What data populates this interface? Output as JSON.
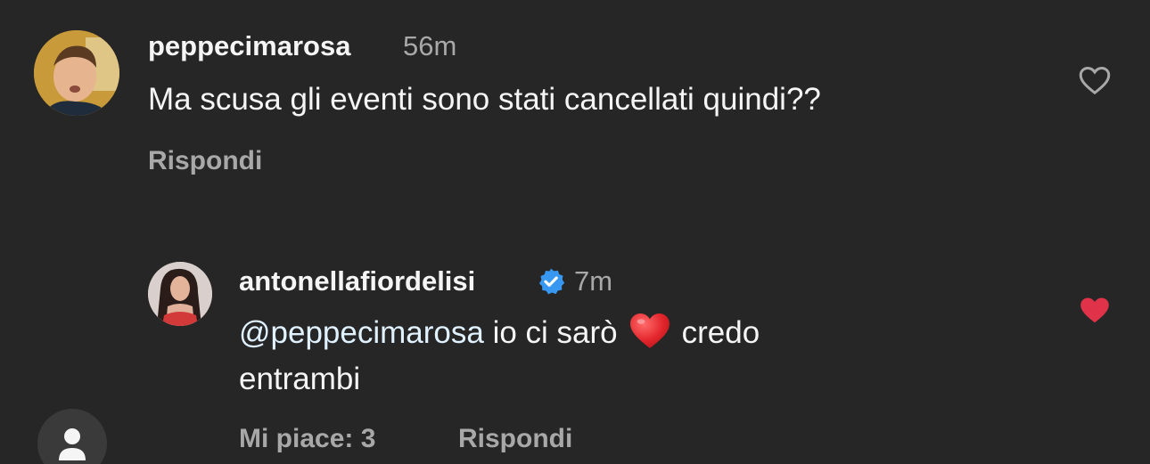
{
  "comments": [
    {
      "username": "peppecimarosa",
      "time": "56m",
      "text": "Ma scusa gli eventi sono stati cancellati quindi??",
      "reply_label": "Rispondi",
      "liked": false
    }
  ],
  "reply": {
    "username": "antonellafiordelisi",
    "verified": true,
    "time": "7m",
    "mention": "@peppecimarosa",
    "text_after_mention": "io ci sarò",
    "text_end_line1": "credo",
    "text_line2": "entrambi",
    "likes_label": "Mi piace: 3",
    "reply_label": "Rispondi",
    "liked": true
  },
  "colors": {
    "background": "#262626",
    "primary_text": "#f5f5f5",
    "secondary_text": "#a8a8a8",
    "like_red": "#e0334a",
    "verified_blue": "#3897f0",
    "mention": "#e0f1ff"
  },
  "icons": {
    "like_empty": "heart-outline-icon",
    "like_filled": "heart-filled-icon",
    "verified": "verified-badge-icon",
    "inline_emoji": "red-heart-emoji",
    "current_user": "user-silhouette-icon"
  }
}
